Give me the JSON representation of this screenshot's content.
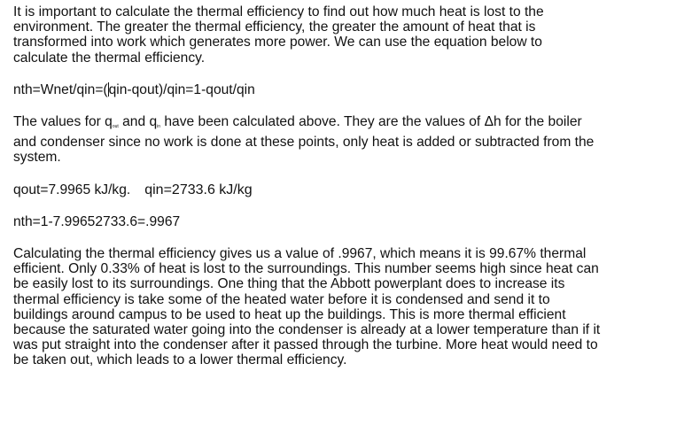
{
  "intro": {
    "lines": [
      "It is important to calculate the thermal efficiency to find out how much heat is lost to the",
      "environment. The greater the thermal efficiency, the greater the amount of heat that is",
      "transformed into work which generates more power. We can use the equation below to",
      "calculate the thermal efficiency."
    ]
  },
  "equation": {
    "before_cursor": "nth=Wnet/qin=(",
    "after_cursor": "qin-qout)/qin=1-qout/qin"
  },
  "values_para": {
    "line1_start": "The values for q",
    "sub1": "out",
    "line1_mid": " and q",
    "sub2": "in",
    "line1_end": " have been calculated above. They are the values of Δh for the boiler",
    "line2": "and condenser since no work is done at these points, only heat is added or subtracted from the",
    "line3": "system."
  },
  "values": {
    "qout": "qout=7.9965 kJ/kg.",
    "qin": "qin=2733.6 kJ/kg"
  },
  "result": {
    "text": "nth=1-7.99652733.6=.9967"
  },
  "conclusion": {
    "lines": [
      "Calculating the thermal efficiency gives us a value of .9967, which means it is 99.67% thermal",
      "efficient. Only 0.33% of heat is lost to the surroundings. This number seems high since heat can",
      "be easily lost to its surroundings. One thing that the Abbott powerplant does to increase its",
      "thermal efficiency is take some of the heated water before it is condensed and send it to",
      "buildings around campus to be used to heat up the buildings. This is more thermal efficient",
      "because the saturated water going into the condenser is already at a lower temperature than if it",
      "was put straight into the condenser after it passed through the turbine. More heat would need to",
      "be taken out, which leads to a lower thermal efficiency."
    ]
  }
}
